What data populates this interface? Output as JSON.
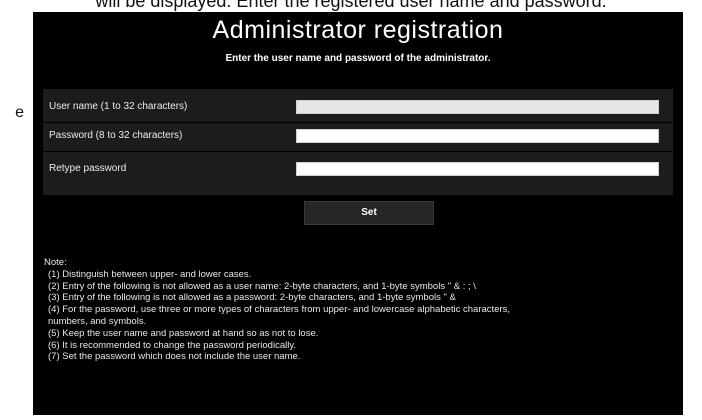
{
  "document": {
    "top_text": "will be displayed. Enter the registered user name and password.",
    "margin_text": "e"
  },
  "dialog": {
    "title": "Administrator registration",
    "subtitle": "Enter the user name and password of the administrator.",
    "fields": [
      {
        "label": "User name (1 to 32 characters)",
        "value": "",
        "type": "text"
      },
      {
        "label": "Password (8 to 32 characters)",
        "value": "",
        "type": "password"
      },
      {
        "label": "Retype password",
        "value": "",
        "type": "password"
      }
    ],
    "set_label": "Set",
    "note_title": "Note:",
    "notes": [
      "(1) Distinguish between upper- and lower cases.",
      "(2) Entry of the following is not allowed as a user name:   2-byte characters, and 1-byte symbols \" & : ; \\",
      "(3) Entry of the following is not allowed as a password:   2-byte characters, and 1-byte symbols \" &",
      "(4) For the password, use three or more types of characters from upper- and lowercase alphabetic characters,",
      "numbers, and symbols.",
      "(5) Keep the user name and password at hand so as not to lose.",
      "(6) It is recommended to change the password periodically.",
      "(7) Set the password which does not include the user name."
    ]
  },
  "colors": {
    "panel_bg": "#000000",
    "form_bg": "#1c1c1c",
    "button_bg": "#262626",
    "text": "#ffffff"
  }
}
